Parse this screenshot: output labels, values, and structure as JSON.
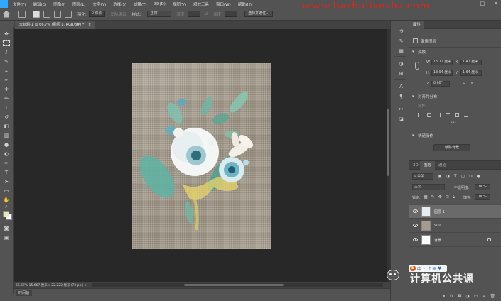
{
  "menu": {
    "items": [
      "文件(F)",
      "编辑(E)",
      "图像(I)",
      "图层(L)",
      "文字(Y)",
      "选择(S)",
      "滤镜(T)",
      "3D(D)",
      "视图(V)",
      "增效工具",
      "窗口(W)",
      "帮助(H)"
    ]
  },
  "watermark": {
    "text": "www.bazhuliansha.com"
  },
  "options": {
    "feather_label": "羽化:",
    "feather_value": "0 像素",
    "antialias_label": "消除锯齿",
    "style_label": "样式:",
    "style_value": "正常",
    "width_label": "宽度:",
    "height_label": "高度:",
    "select_mask_label": "选择并遮住..."
  },
  "document": {
    "tab_title": "未标题-1 @ 66.7% (图层 1, RGB/8#) *",
    "tab_close": "×"
  },
  "status": {
    "zoom_info": "66.67%  15.667 厘米 x 22.222 厘米 (72 ppi)  >"
  },
  "timeline": {
    "label": "时间轴"
  },
  "properties": {
    "tab_label": "属性",
    "layer_type": "像素图层",
    "transform_section": "变换",
    "w_label": "W",
    "w_value": "13.72 厘米",
    "h_label": "H",
    "h_value": "18.94 厘米",
    "x_label": "X",
    "x_value": "1.47 厘米",
    "y_label": "Y",
    "y_value": "1.64 厘米",
    "angle_value": "0.00°",
    "align_section": "对齐并分布",
    "align_label": "对齐:",
    "quick_section": "快速操作",
    "remove_bg_button": "移除背景"
  },
  "layers": {
    "tabs": [
      "3D",
      "图层",
      "通道"
    ],
    "filter_kind": "类型",
    "blend_mode": "正常",
    "opacity_label": "不透明度:",
    "opacity_value": "100%",
    "lock_label": "锁定:",
    "fill_label": "填充:",
    "fill_value": "100%",
    "rows": [
      {
        "name": "图层 1",
        "selected": true,
        "locked": false
      },
      {
        "name": "900",
        "selected": false,
        "locked": false
      },
      {
        "name": "背景",
        "selected": false,
        "locked": true
      }
    ],
    "footer_icons": [
      "link-icon",
      "fx-icon",
      "mask-icon",
      "adjustment-icon",
      "folder-icon",
      "new-layer-icon",
      "trash-icon"
    ],
    "footer_fx": "fx"
  },
  "overlay": {
    "wechat_account": "计算机公共课",
    "ime_mode": "中"
  },
  "colors": {
    "foreground": "#e8e6c0",
    "background": "#ffffff",
    "workspace": "#282828",
    "panel": "#535353",
    "watermark": "#e0241e"
  }
}
